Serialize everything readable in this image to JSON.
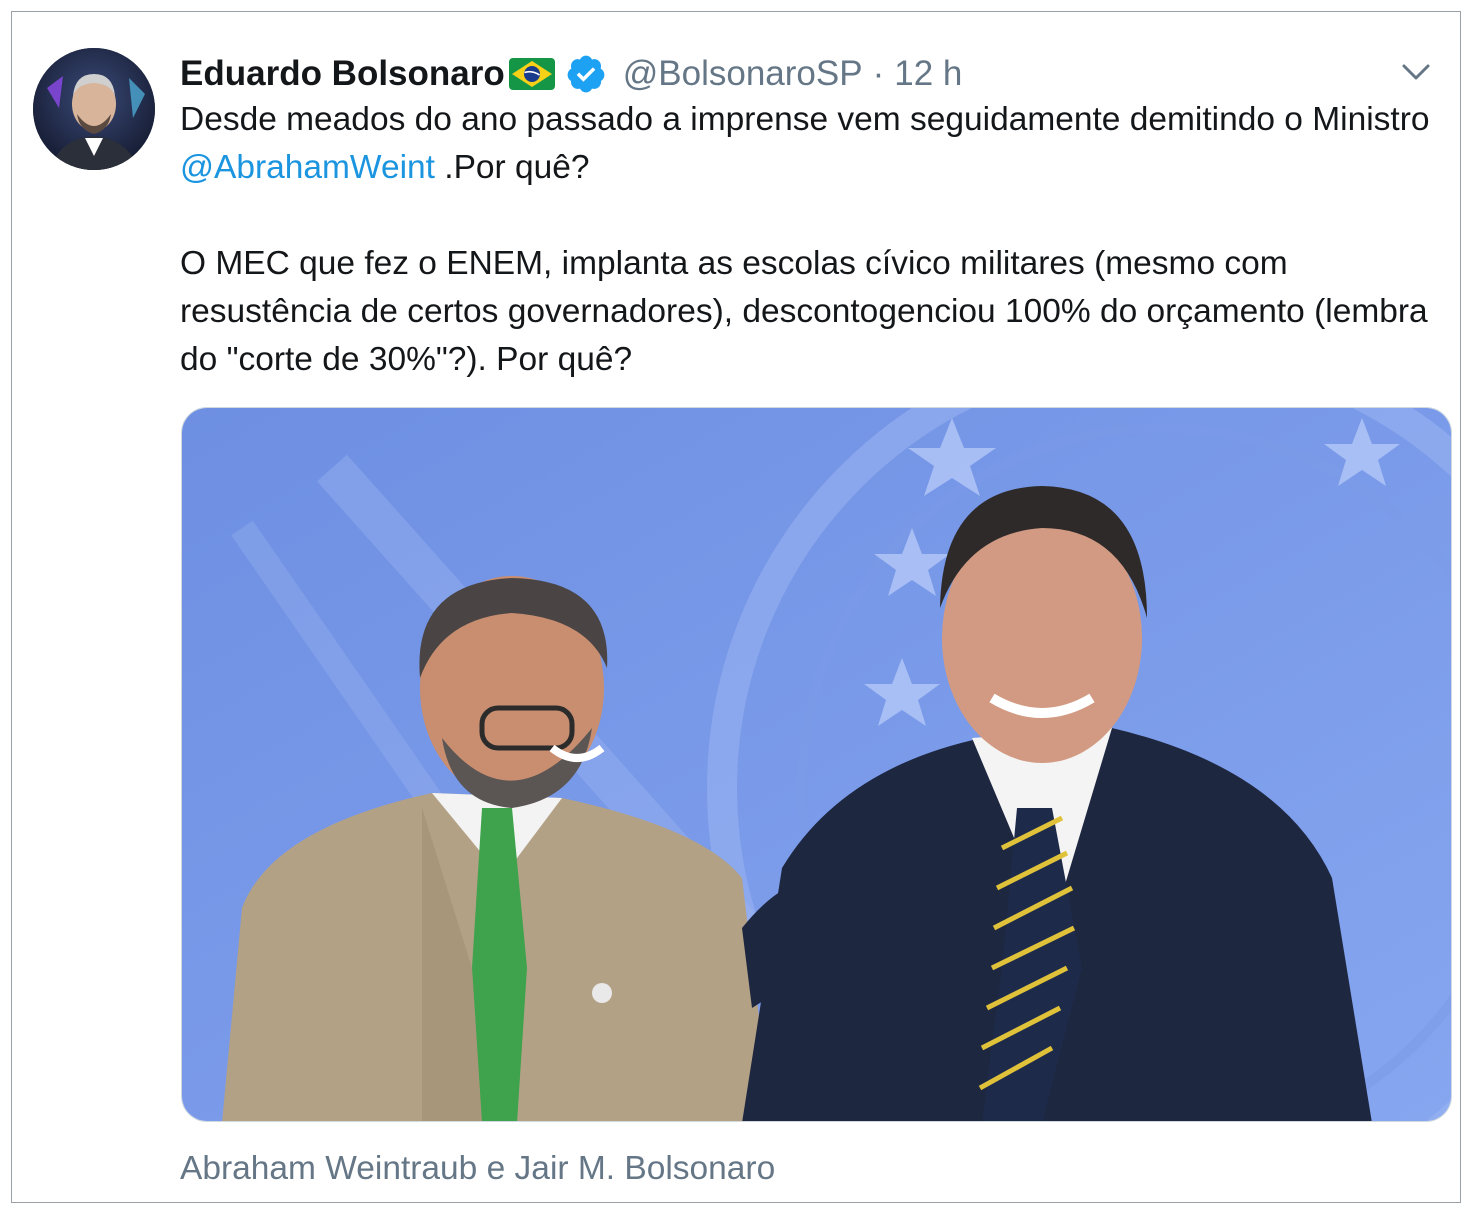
{
  "tweet": {
    "display_name": "Eduardo Bolsonaro",
    "flag_icon": "brazil-flag-emoji",
    "verified_icon": "verified-badge-icon",
    "handle": "@BolsonaroSP",
    "separator": "·",
    "timestamp": "12 h",
    "menu_icon": "chevron-down-icon",
    "text": {
      "line1_part1": "Desde meados do ano passado a imprense vem seguidamente demitindo o Ministro ",
      "mention": "@AbrahamWeint",
      "line1_part2": " .Por quê?",
      "paragraph2": "O MEC que fez o ENEM, implanta as escolas cívico militares (mesmo com resustência de certos governadores), descontogenciou 100% do orçamento (lembra do \"corte de 30%\"?). Por quê?"
    },
    "media_caption": "Abraham Weintraub e Jair M. Bolsonaro"
  },
  "colors": {
    "text": "#14171a",
    "secondary": "#657786",
    "link": "#1b95e0",
    "verified": "#1da1f2",
    "photo_background": "#6f93e6"
  }
}
